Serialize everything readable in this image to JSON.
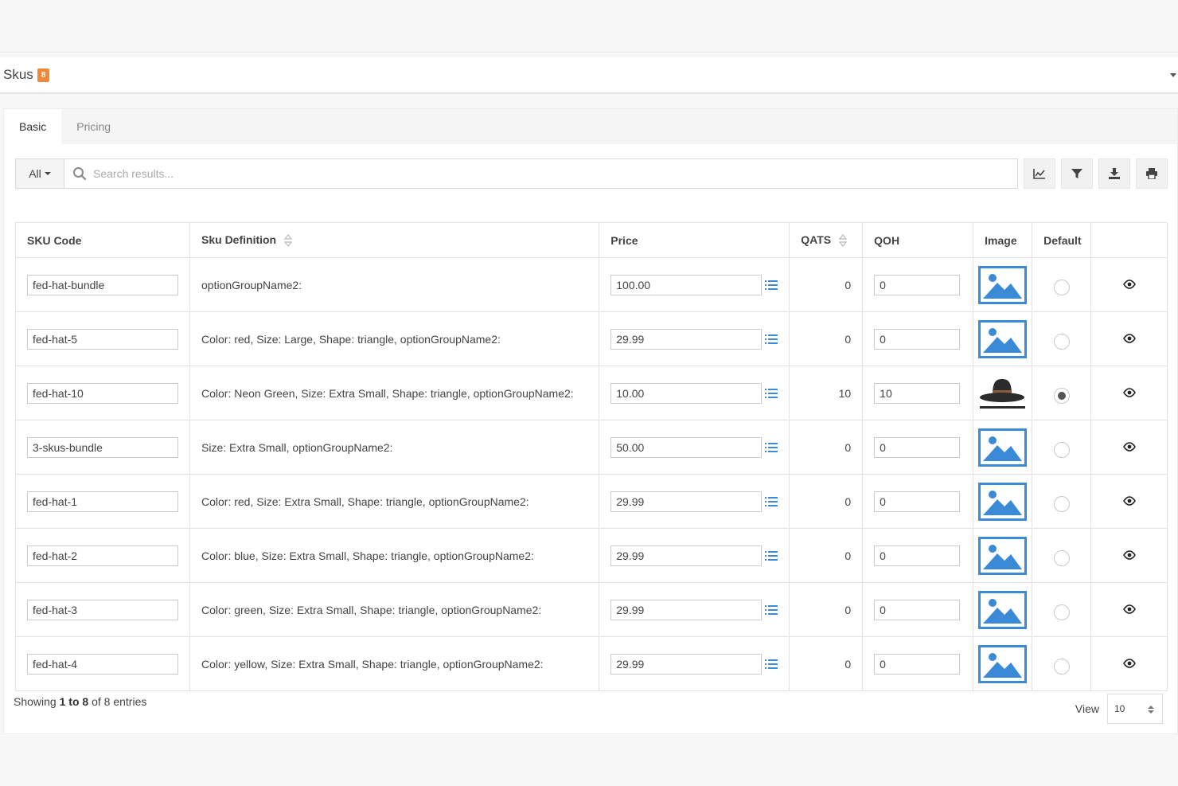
{
  "panel": {
    "title": "Skus",
    "count": "8"
  },
  "tabs": [
    {
      "label": "Basic"
    },
    {
      "label": "Pricing"
    }
  ],
  "search": {
    "filter": "All",
    "placeholder": "Search results..."
  },
  "toolbar_icons": [
    "chart-icon",
    "filter-icon",
    "download-icon",
    "print-icon"
  ],
  "columns": {
    "sku_code": "SKU Code",
    "sku_definition": "Sku Definition",
    "price": "Price",
    "qats": "QATS",
    "qoh": "QOH",
    "image": "Image",
    "default": "Default"
  },
  "rows": [
    {
      "sku": "fed-hat-bundle",
      "definition": "optionGroupName2:",
      "price": "100.00",
      "qats": "0",
      "qoh": "0",
      "image": "placeholder-image",
      "default": false
    },
    {
      "sku": "fed-hat-5",
      "definition": "Color: red, Size: Large, Shape: triangle, optionGroupName2:",
      "price": "29.99",
      "qats": "0",
      "qoh": "0",
      "image": "placeholder-image",
      "default": false
    },
    {
      "sku": "fed-hat-10",
      "definition": "Color: Neon Green, Size: Extra Small, Shape: triangle, optionGroupName2:",
      "price": "10.00",
      "qats": "10",
      "qoh": "10",
      "image": "hat-image",
      "default": true
    },
    {
      "sku": "3-skus-bundle",
      "definition": "Size: Extra Small, optionGroupName2:",
      "price": "50.00",
      "qats": "0",
      "qoh": "0",
      "image": "placeholder-image",
      "default": false
    },
    {
      "sku": "fed-hat-1",
      "definition": "Color: red, Size: Extra Small, Shape: triangle, optionGroupName2:",
      "price": "29.99",
      "qats": "0",
      "qoh": "0",
      "image": "placeholder-image",
      "default": false
    },
    {
      "sku": "fed-hat-2",
      "definition": "Color: blue, Size: Extra Small, Shape: triangle, optionGroupName2:",
      "price": "29.99",
      "qats": "0",
      "qoh": "0",
      "image": "placeholder-image",
      "default": false
    },
    {
      "sku": "fed-hat-3",
      "definition": "Color: green, Size: Extra Small, Shape: triangle, optionGroupName2:",
      "price": "29.99",
      "qats": "0",
      "qoh": "0",
      "image": "placeholder-image",
      "default": false
    },
    {
      "sku": "fed-hat-4",
      "definition": "Color: yellow, Size: Extra Small, Shape: triangle, optionGroupName2:",
      "price": "29.99",
      "qats": "0",
      "qoh": "0",
      "image": "placeholder-image",
      "default": false
    }
  ],
  "footer": {
    "showing_prefix": "Showing",
    "from": "1",
    "to_word": "to",
    "to": "8",
    "of_word": "of",
    "total": "8",
    "entries_word": "entries",
    "view_label": "View",
    "page_size": "10"
  },
  "colors": {
    "badge": "#f0883a",
    "accent_blue": "#3a8ad8"
  }
}
